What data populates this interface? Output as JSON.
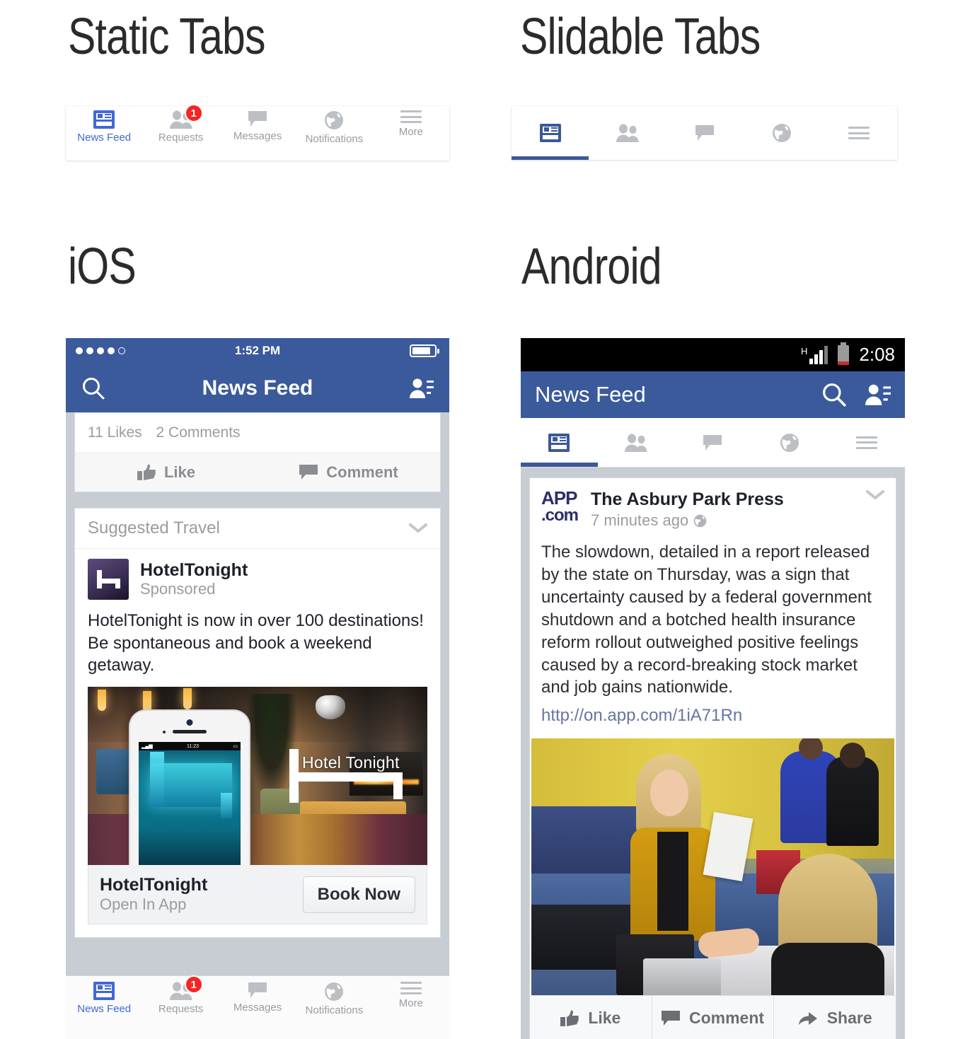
{
  "headings": {
    "static_tabs": "Static Tabs",
    "slidable_tabs": "Slidable Tabs",
    "ios": "iOS",
    "android": "Android"
  },
  "tabs": {
    "items": [
      {
        "label": "News Feed",
        "icon": "news-feed-icon",
        "badge": ""
      },
      {
        "label": "Requests",
        "icon": "friend-requests-icon",
        "badge": "1"
      },
      {
        "label": "Messages",
        "icon": "messages-icon",
        "badge": ""
      },
      {
        "label": "Notifications",
        "icon": "globe-notifications-icon",
        "badge": ""
      },
      {
        "label": "More",
        "icon": "hamburger-more-icon",
        "badge": ""
      }
    ],
    "active_index": 0,
    "active_color": "#4267d6",
    "inactive_color": "#9a9ca0",
    "android_indicator_color": "#3b5998"
  },
  "ios": {
    "status": {
      "time": "1:52 PM",
      "signal_dots": 5,
      "signal_filled": 4
    },
    "nav": {
      "title": "News Feed",
      "search_icon": "search-icon",
      "friends_icon": "friend-requests-icon"
    },
    "feed_top": {
      "likes": "11 Likes",
      "comments": "2 Comments",
      "like_label": "Like",
      "comment_label": "Comment"
    },
    "suggested": {
      "header": "Suggested Travel",
      "chevron": "chevron-down-icon",
      "advertiser": "HotelTonight",
      "sponsored": "Sponsored",
      "body": "HotelTonight is now in over 100 destinations! Be spontaneous and book a weekend getaway.",
      "photo_sign_text": "Hotel Tonight",
      "photo_phone_time": "11:23",
      "footer_name": "HotelTonight",
      "footer_sub": "Open In App",
      "cta": "Book Now"
    }
  },
  "android": {
    "status": {
      "time": "2:08",
      "network": "H"
    },
    "nav": {
      "title": "News Feed",
      "search_icon": "search-icon",
      "friends_icon": "friend-requests-icon"
    },
    "post": {
      "author": "The Asbury Park Press",
      "logo_line1": "APP",
      "logo_line2": ".com",
      "timestamp": "7 minutes ago",
      "privacy_icon": "globe-privacy-icon",
      "chevron": "chevron-down-icon",
      "body": "The slowdown, detailed in a report released by the state on Thursday, was a sign that uncertainty caused by a federal government shutdown and a botched health insurance reform rollout outweighed positive feelings caused by a record-breaking stock market and job gains nationwide.",
      "link": "http://on.app.com/1iA71Rn",
      "actions": [
        {
          "label": "Like",
          "icon": "thumbs-up-icon"
        },
        {
          "label": "Comment",
          "icon": "comment-icon"
        },
        {
          "label": "Share",
          "icon": "share-arrow-icon"
        }
      ]
    }
  },
  "colors": {
    "fb_blue": "#3b5a9b",
    "fb_dark_blue": "#3b5998",
    "tab_active": "#4267d6",
    "badge_red": "#f82424",
    "link_blue": "#6675a3"
  }
}
